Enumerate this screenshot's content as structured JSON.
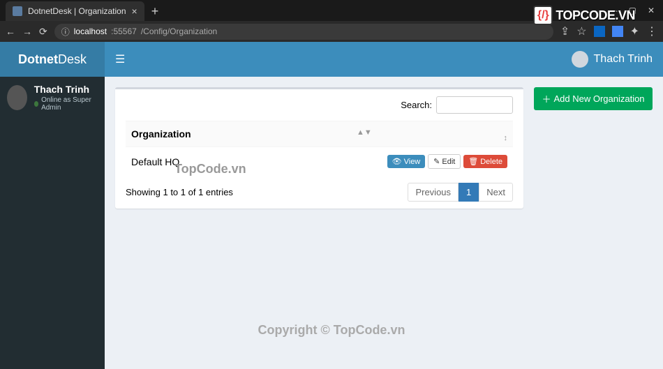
{
  "browser": {
    "tab_title": "DotnetDesk | Organization",
    "url_host": "localhost",
    "url_port": ":55567",
    "url_path": "/Config/Organization"
  },
  "header": {
    "logo_bold": "Dotnet",
    "logo_light": "Desk",
    "user_name": "Thach Trinh"
  },
  "sidebar": {
    "user_name": "Thach Trinh",
    "user_status": "Online as Super Admin"
  },
  "search": {
    "label": "Search:",
    "value": ""
  },
  "table": {
    "columns": [
      "Organization",
      ""
    ],
    "rows": [
      {
        "name": "Default HQ",
        "view": "View",
        "edit": "Edit",
        "delete": "Delete"
      }
    ],
    "info": "Showing 1 to 1 of 1 entries"
  },
  "pagination": {
    "prev": "Previous",
    "pages": [
      "1"
    ],
    "next": "Next"
  },
  "actions": {
    "add_new": "Add New Organization"
  },
  "watermark": {
    "brand_icon": "{/}",
    "brand": "TOPCODE.VN",
    "center": "TopCode.vn",
    "bottom": "Copyright © TopCode.vn"
  }
}
